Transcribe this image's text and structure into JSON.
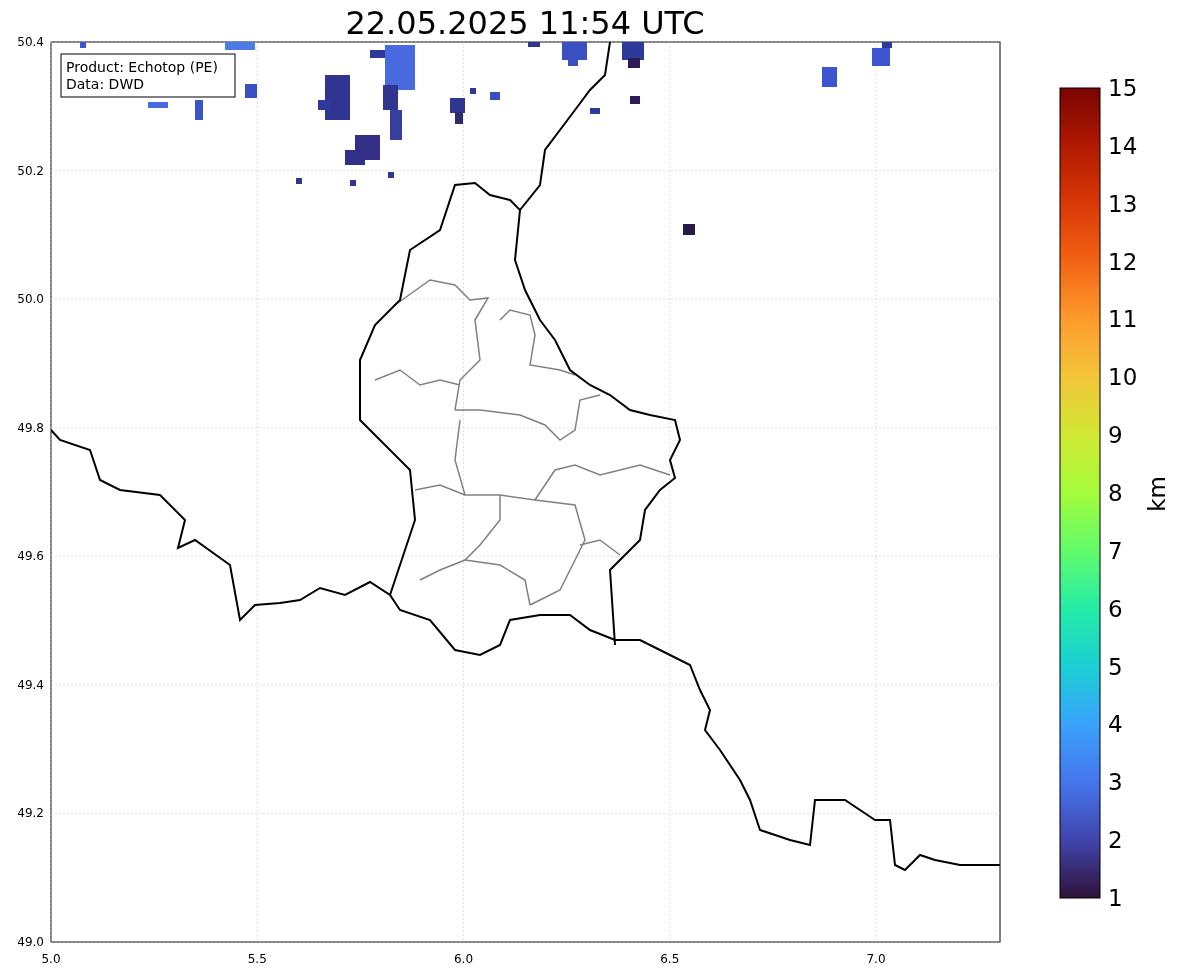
{
  "title": "22.05.2025 11:54 UTC",
  "info_box": {
    "lines": [
      "Product: Echotop (PE)",
      "Data: DWD"
    ]
  },
  "x_axis": {
    "ticks": [
      "5.0",
      "5.5",
      "6.0",
      "6.5",
      "7.0"
    ]
  },
  "y_axis": {
    "ticks": [
      "50.4",
      "50.2",
      "50.0",
      "49.8",
      "49.6",
      "49.4",
      "49.2",
      "49.0"
    ]
  },
  "colorbar": {
    "label": "km",
    "ticks": [
      "15",
      "14",
      "13",
      "12",
      "11",
      "10",
      "9",
      "8",
      "7",
      "6",
      "5",
      "4",
      "3",
      "2",
      "1"
    ]
  }
}
